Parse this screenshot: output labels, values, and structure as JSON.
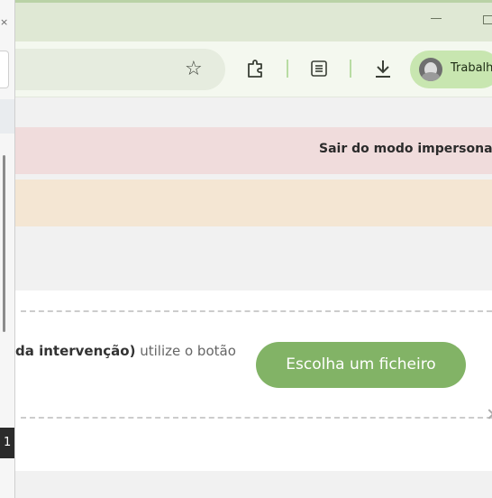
{
  "browser": {
    "profile_name": "Trabalho",
    "icons": {
      "star": "bookmark-star-icon",
      "extensions": "puzzle-extensions-icon",
      "reading": "reading-list-icon",
      "download": "download-icon",
      "minimize": "minimize-icon",
      "maximize": "maximize-icon"
    },
    "star_glyph": "☆"
  },
  "sidepanel": {
    "close_glyph": "×",
    "badge": "1"
  },
  "page": {
    "banner_red_text": "Sair do modo impersonar",
    "upload": {
      "text_bold": "da intervenção)",
      "text_rest": " utilize o botão",
      "button_label": "Escolha um ficheiro"
    }
  },
  "colors": {
    "accent_green": "#82b366",
    "banner_red": "#f0dcdc",
    "banner_amber": "#f4e6d3",
    "chrome": "#dfe8d4"
  }
}
